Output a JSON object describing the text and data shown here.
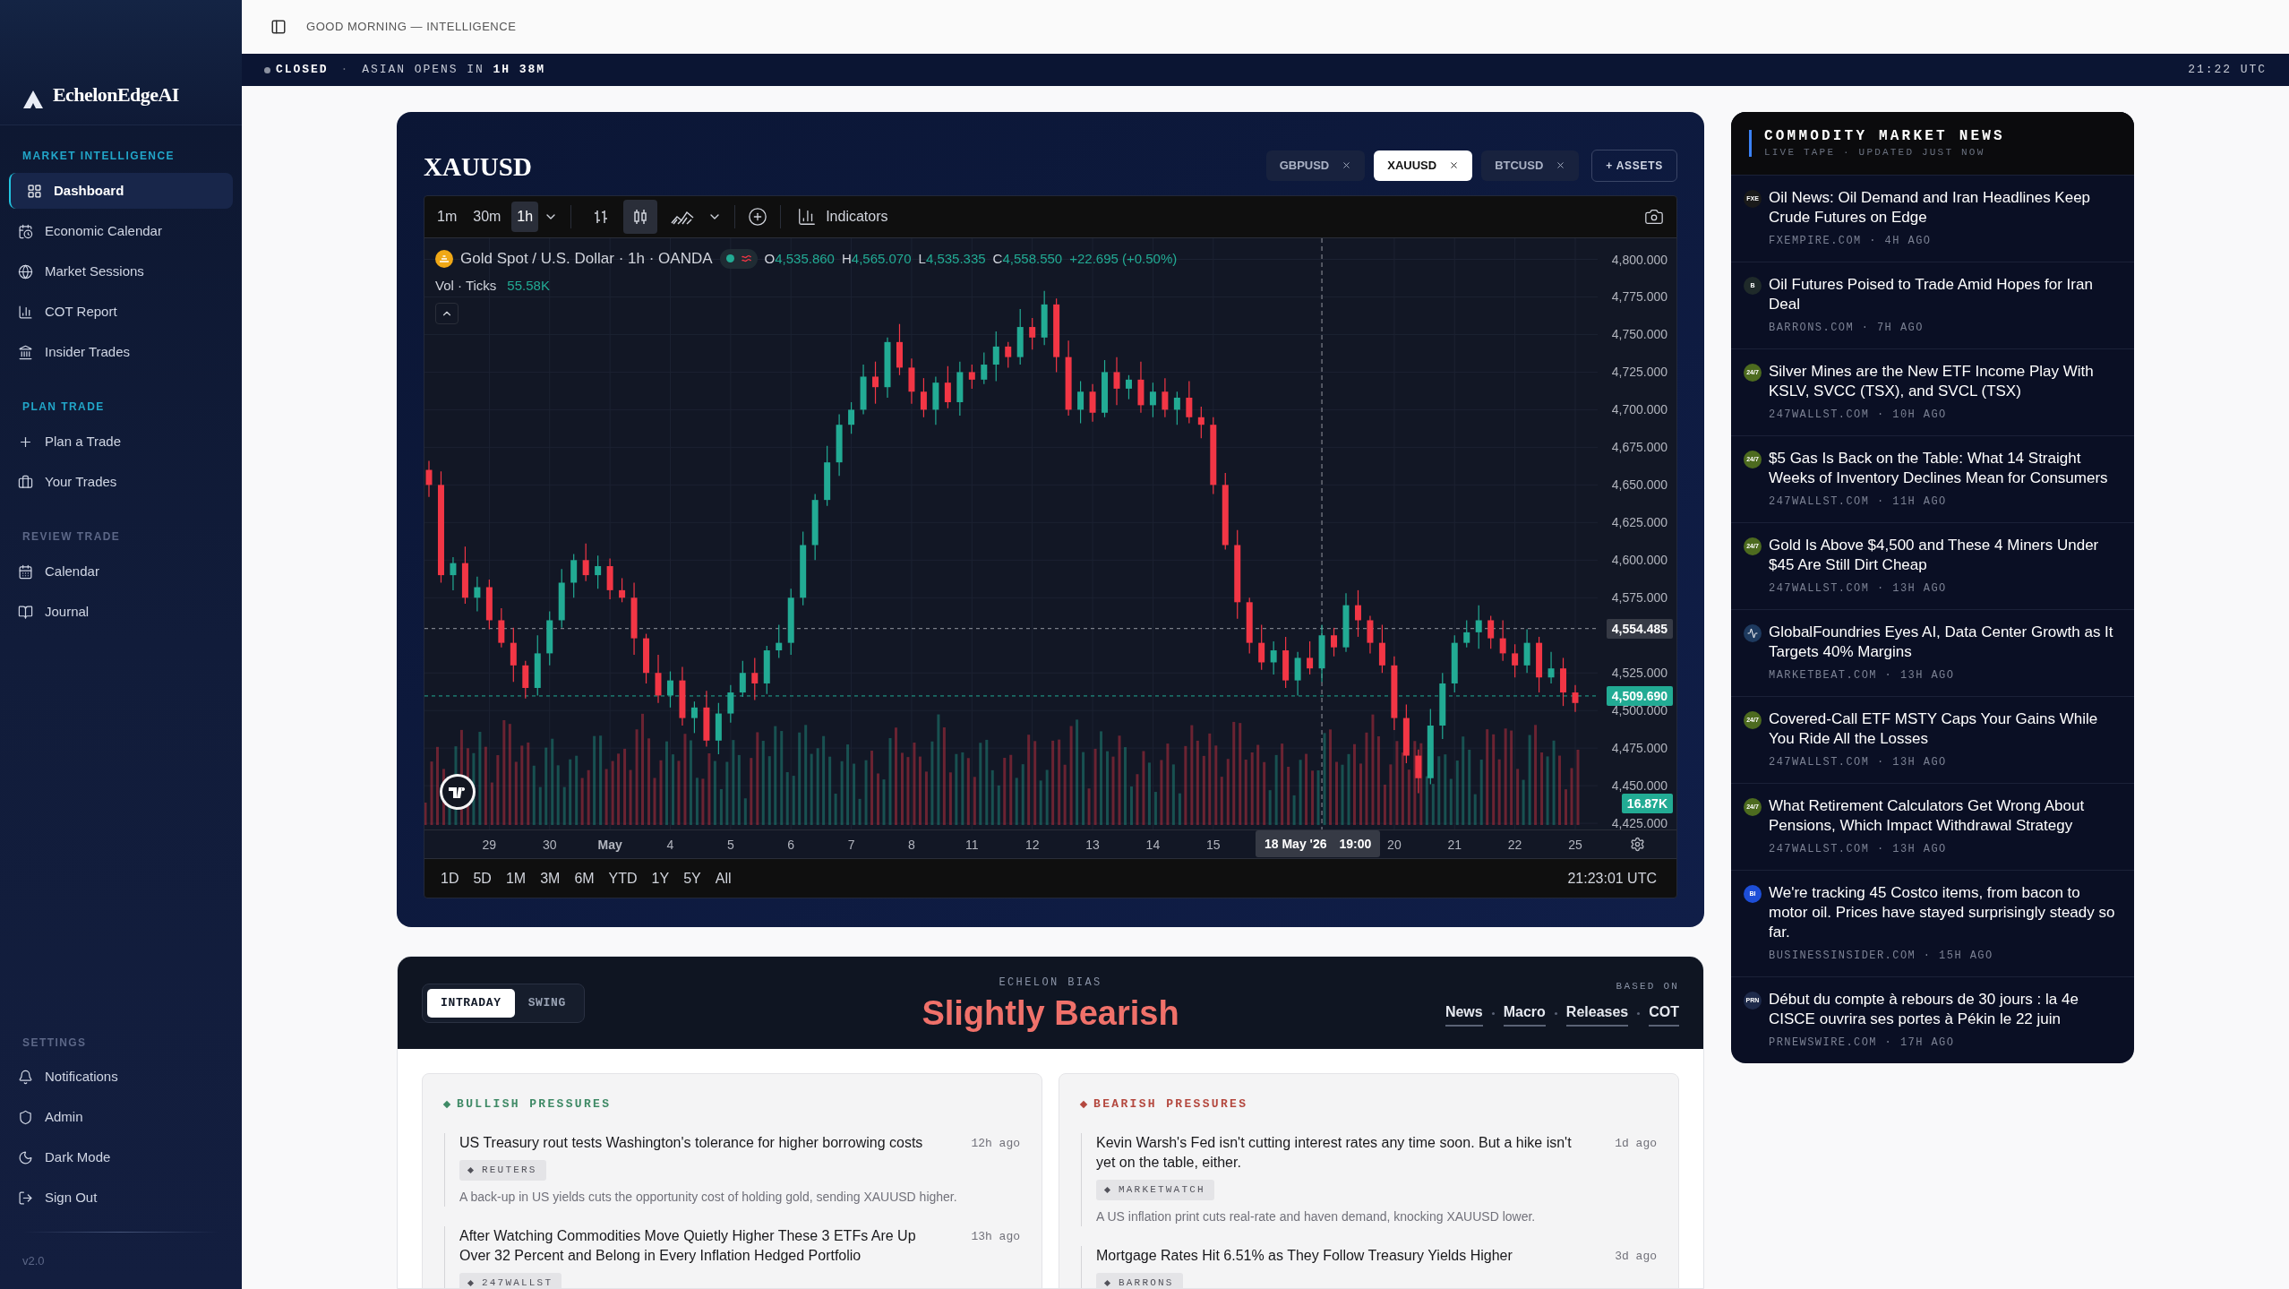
{
  "sidebar": {
    "brand": "EchelonEdgeAI",
    "sections": [
      {
        "title": "MARKET INTELLIGENCE",
        "accent": true,
        "items": [
          {
            "label": "Dashboard",
            "selected": true
          },
          {
            "label": "Economic Calendar",
            "selected": false
          },
          {
            "label": "Market Sessions",
            "selected": false
          },
          {
            "label": "COT Report",
            "selected": false
          },
          {
            "label": "Insider Trades",
            "selected": false
          }
        ]
      },
      {
        "title": "PLAN TRADE",
        "accent": true,
        "items": [
          {
            "label": "Plan a Trade",
            "selected": false
          },
          {
            "label": "Your Trades",
            "selected": false
          }
        ]
      },
      {
        "title": "REVIEW TRADE",
        "accent": false,
        "items": [
          {
            "label": "Calendar",
            "selected": false
          },
          {
            "label": "Journal",
            "selected": false
          }
        ]
      },
      {
        "title": "SETTINGS",
        "accent": false,
        "items": [
          {
            "label": "Notifications",
            "selected": false
          },
          {
            "label": "Admin",
            "selected": false
          },
          {
            "label": "Dark Mode",
            "selected": false
          },
          {
            "label": "Sign Out",
            "selected": false
          }
        ]
      }
    ],
    "version": "v2.0"
  },
  "header": {
    "greeting": "GOOD MORNING — INTELLIGENCE"
  },
  "ticker": {
    "open": false,
    "status": "CLOSED",
    "separator": "·",
    "countdown": "ASIAN OPENS IN **1H 38M**",
    "time": "21:22 UTC"
  },
  "chart_card": {
    "title": "XAUUSD",
    "assets": [
      {
        "label": "GBPUSD",
        "selected": false
      },
      {
        "label": "XAUUSD",
        "selected": true
      },
      {
        "label": "BTCUSD",
        "selected": false
      }
    ],
    "add_button": "+ ASSETS",
    "intervals": [
      {
        "label": "1m",
        "selected": false
      },
      {
        "label": "30m",
        "selected": false
      },
      {
        "label": "1h",
        "selected": true
      }
    ],
    "chart_types": [
      {
        "kind": "bars",
        "selected": false
      },
      {
        "kind": "candles",
        "selected": true
      },
      {
        "kind": "area",
        "selected": false
      }
    ],
    "indicators": "Indicators",
    "legend": {
      "symbol": "Gold Spot / U.S. Dollar · 1h · OANDA",
      "ohlc": [
        {
          "key": "O",
          "value": "4,535.860"
        },
        {
          "key": "H",
          "value": "4,565.070"
        },
        {
          "key": "L",
          "value": "4,535.335"
        },
        {
          "key": "C",
          "value": "4,558.550"
        }
      ],
      "change": "+22.695 (+0.50%)",
      "volume_label": "Vol · Ticks",
      "volume_value": "55.58K"
    },
    "price_markers": [
      {
        "kind": "crosshair",
        "label": "4,554.485"
      },
      {
        "kind": "last",
        "label": "4,509.690"
      },
      {
        "kind": "volume",
        "label": "16.87K"
      }
    ],
    "crosshair_time": {
      "date": "18 May '26",
      "time": "19:00"
    },
    "chart_data": {
      "type": "candlestick",
      "grid": true,
      "ylim": [
        4420.9,
        4814
      ],
      "categories": [
        null,
        null,
        null,
        null,
        null,
        "29",
        null,
        null,
        null,
        null,
        "30",
        null,
        null,
        null,
        null,
        "May",
        null,
        null,
        null,
        null,
        "4",
        null,
        null,
        null,
        null,
        "5",
        null,
        null,
        null,
        null,
        "6",
        null,
        null,
        null,
        null,
        "7",
        null,
        null,
        null,
        null,
        "8",
        null,
        null,
        null,
        null,
        "11",
        null,
        null,
        null,
        null,
        "12",
        null,
        null,
        null,
        null,
        "13",
        null,
        null,
        null,
        null,
        "14",
        null,
        null,
        null,
        null,
        "15",
        null,
        null,
        null,
        null,
        null,
        null,
        null,
        null,
        null,
        null,
        null,
        null,
        null,
        null,
        "20",
        null,
        null,
        null,
        null,
        "21",
        null,
        null,
        null,
        null,
        "22",
        null,
        null,
        null,
        null,
        "25"
      ],
      "ref_lines": [
        {
          "axis": "y",
          "value": 4554.485,
          "color": "#9598a1"
        },
        {
          "axis": "y",
          "value": 4509.69,
          "color": "#22ab94"
        }
      ],
      "yticks": [
        {
          "value": 4800,
          "label": "4,800.000"
        },
        {
          "value": 4775,
          "label": "4,775.000"
        },
        {
          "value": 4750,
          "label": "4,750.000"
        },
        {
          "value": 4725,
          "label": "4,725.000"
        },
        {
          "value": 4700,
          "label": "4,700.000"
        },
        {
          "value": 4675,
          "label": "4,675.000"
        },
        {
          "value": 4650,
          "label": "4,650.000"
        },
        {
          "value": 4625,
          "label": "4,625.000"
        },
        {
          "value": 4600,
          "label": "4,600.000"
        },
        {
          "value": 4575,
          "label": "4,575.000"
        },
        {
          "value": 4525,
          "label": "4,525.000"
        },
        {
          "value": 4500,
          "label": "4,500.000"
        },
        {
          "value": 4475,
          "label": "4,475.000"
        },
        {
          "value": 4450,
          "label": "4,450.000"
        },
        {
          "value": 4425,
          "label": "4,425.000"
        }
      ],
      "ohlc": [
        [
          4660,
          4666,
          4642,
          4650
        ],
        [
          4650,
          4659,
          4585,
          4590
        ],
        [
          4590,
          4602,
          4580,
          4598
        ],
        [
          4598,
          4609,
          4571,
          4575
        ],
        [
          4575,
          4589,
          4566,
          4582
        ],
        [
          4582,
          4587,
          4554,
          4560
        ],
        [
          4560,
          4568,
          4542,
          4545
        ],
        [
          4545,
          4555,
          4519,
          4530
        ],
        [
          4530,
          4533,
          4508,
          4515
        ],
        [
          4515,
          4550,
          4510,
          4538
        ],
        [
          4538,
          4566,
          4530,
          4560
        ],
        [
          4560,
          4594,
          4555,
          4585
        ],
        [
          4585,
          4604,
          4575,
          4600
        ],
        [
          4600,
          4611,
          4586,
          4590
        ],
        [
          4590,
          4603,
          4581,
          4596
        ],
        [
          4596,
          4601,
          4574,
          4580
        ],
        [
          4580,
          4588,
          4572,
          4575
        ],
        [
          4575,
          4585,
          4537,
          4548
        ],
        [
          4548,
          4551,
          4518,
          4525
        ],
        [
          4525,
          4537,
          4505,
          4510
        ],
        [
          4510,
          4526,
          4502,
          4520
        ],
        [
          4520,
          4529,
          4490,
          4495
        ],
        [
          4495,
          4506,
          4485,
          4502
        ],
        [
          4502,
          4513,
          4476,
          4480
        ],
        [
          4480,
          4505,
          4471,
          4498
        ],
        [
          4498,
          4517,
          4492,
          4512
        ],
        [
          4512,
          4533,
          4509,
          4525
        ],
        [
          4525,
          4535,
          4507,
          4518
        ],
        [
          4518,
          4543,
          4511,
          4540
        ],
        [
          4540,
          4557,
          4535,
          4545
        ],
        [
          4545,
          4581,
          4537,
          4575
        ],
        [
          4575,
          4619,
          4570,
          4610
        ],
        [
          4610,
          4644,
          4600,
          4640
        ],
        [
          4640,
          4676,
          4636,
          4665
        ],
        [
          4665,
          4697,
          4656,
          4690
        ],
        [
          4690,
          4705,
          4684,
          4700
        ],
        [
          4700,
          4730,
          4697,
          4722
        ],
        [
          4722,
          4732,
          4704,
          4715
        ],
        [
          4715,
          4748,
          4708,
          4745
        ],
        [
          4745,
          4757,
          4723,
          4728
        ],
        [
          4728,
          4734,
          4704,
          4712
        ],
        [
          4712,
          4721,
          4695,
          4700
        ],
        [
          4700,
          4722,
          4690,
          4718
        ],
        [
          4718,
          4729,
          4701,
          4705
        ],
        [
          4705,
          4732,
          4696,
          4725
        ],
        [
          4725,
          4730,
          4714,
          4720
        ],
        [
          4720,
          4738,
          4717,
          4730
        ],
        [
          4730,
          4752,
          4719,
          4742
        ],
        [
          4742,
          4745,
          4728,
          4735
        ],
        [
          4735,
          4767,
          4730,
          4755
        ],
        [
          4755,
          4761,
          4740,
          4748
        ],
        [
          4748,
          4779,
          4743,
          4770
        ],
        [
          4770,
          4774,
          4725,
          4735
        ],
        [
          4735,
          4746,
          4696,
          4700
        ],
        [
          4700,
          4719,
          4691,
          4712
        ],
        [
          4712,
          4717,
          4692,
          4698
        ],
        [
          4698,
          4733,
          4695,
          4725
        ],
        [
          4725,
          4735,
          4703,
          4714
        ],
        [
          4714,
          4723,
          4707,
          4720
        ],
        [
          4720,
          4732,
          4698,
          4703
        ],
        [
          4703,
          4718,
          4695,
          4712
        ],
        [
          4712,
          4721,
          4695,
          4700
        ],
        [
          4700,
          4712,
          4690,
          4708
        ],
        [
          4708,
          4719,
          4691,
          4695
        ],
        [
          4695,
          4702,
          4681,
          4690
        ],
        [
          4690,
          4695,
          4644,
          4650
        ],
        [
          4650,
          4658,
          4607,
          4610
        ],
        [
          4610,
          4620,
          4561,
          4572
        ],
        [
          4572,
          4575,
          4538,
          4545
        ],
        [
          4545,
          4557,
          4527,
          4532
        ],
        [
          4532,
          4546,
          4524,
          4540
        ],
        [
          4540,
          4549,
          4515,
          4520
        ],
        [
          4520,
          4539,
          4510,
          4535
        ],
        [
          4535,
          4546,
          4524,
          4528
        ],
        [
          4528,
          4557,
          4519,
          4550
        ],
        [
          4550,
          4555,
          4536,
          4542
        ],
        [
          4542,
          4578,
          4539,
          4570
        ],
        [
          4570,
          4580,
          4549,
          4560
        ],
        [
          4560,
          4563,
          4538,
          4545
        ],
        [
          4545,
          4557,
          4525,
          4530
        ],
        [
          4530,
          4536,
          4487,
          4495
        ],
        [
          4495,
          4504,
          4465,
          4470
        ],
        [
          4470,
          4474,
          4445,
          4455
        ],
        [
          4455,
          4501,
          4451,
          4490
        ],
        [
          4490,
          4525,
          4481,
          4518
        ],
        [
          4518,
          4550,
          4512,
          4545
        ],
        [
          4545,
          4560,
          4542,
          4552
        ],
        [
          4552,
          4570,
          4541,
          4560
        ],
        [
          4560,
          4563,
          4541,
          4548
        ],
        [
          4548,
          4560,
          4533,
          4538
        ],
        [
          4538,
          4544,
          4522,
          4530
        ],
        [
          4530,
          4554,
          4525,
          4545
        ],
        [
          4545,
          4549,
          4512,
          4522
        ],
        [
          4522,
          4539,
          4518,
          4528
        ],
        [
          4528,
          4535,
          4503,
          4512
        ],
        [
          4512,
          4517,
          4499,
          4505
        ]
      ]
    },
    "ranges": [
      "1D",
      "5D",
      "1M",
      "3M",
      "6M",
      "YTD",
      "1Y",
      "5Y",
      "All"
    ],
    "clock": "21:23:01 UTC"
  },
  "bias": {
    "modes": [
      {
        "label": "INTRADAY",
        "selected": true
      },
      {
        "label": "SWING",
        "selected": false
      }
    ],
    "caption": "ECHELON BIAS",
    "verdict": "Slightly Bearish",
    "based_on": "BASED ON",
    "sources": [
      "News",
      "Macro",
      "Releases",
      "COT"
    ],
    "columns": [
      {
        "kind": "bullish",
        "title": "BULLISH PRESSURES",
        "items": [
          {
            "title": "US Treasury rout tests Washington's tolerance for higher borrowing costs",
            "time": "12h ago",
            "source": "REUTERS",
            "summary": "A back-up in US yields cuts the opportunity cost of holding gold, sending XAUUSD higher."
          },
          {
            "title": "After Watching Commodities Move Quietly Higher These 3 ETFs Are Up Over 32 Percent and Belong in Every Inflation Hedged Portfolio",
            "time": "13h ago",
            "source": "247WALLST"
          }
        ]
      },
      {
        "kind": "bearish",
        "title": "BEARISH PRESSURES",
        "items": [
          {
            "title": "Kevin Warsh's Fed isn't cutting interest rates any time soon. But a hike isn't yet on the table, either.",
            "time": "1d ago",
            "source": "MARKETWATCH",
            "summary": "A US inflation print cuts real-rate and haven demand, knocking XAUUSD lower."
          },
          {
            "title": "Mortgage Rates Hit 6.51% as They Follow Treasury Yields Higher",
            "time": "3d ago",
            "source": "BARRONS"
          }
        ]
      }
    ]
  },
  "news": {
    "title": "COMMODITY MARKET NEWS",
    "subtitle": "LIVE TAPE · UPDATED JUST NOW",
    "items": [
      {
        "logo": {
          "kind": "letters",
          "text": "FXE"
        },
        "color": "#1a1a1a",
        "title": "Oil News: Oil Demand and Iran Headlines Keep Crude Futures on Edge",
        "meta": "FXEMPIRE.COM · 4H AGO"
      },
      {
        "logo": {
          "kind": "letters",
          "text": "B"
        },
        "color": "#1f2a2a",
        "title": "Oil Futures Poised to Trade Amid Hopes for Iran Deal",
        "meta": "BARRONS.COM · 7H AGO"
      },
      {
        "logo": {
          "kind": "letters",
          "text": "24/7"
        },
        "color": "#4d6b1f",
        "title": "Silver Mines are the New ETF Income Play With KSLV, SVCC (TSX), and SVCL (TSX)",
        "meta": "247WALLST.COM · 10H AGO"
      },
      {
        "logo": {
          "kind": "letters",
          "text": "24/7"
        },
        "color": "#4d6b1f",
        "title": "$5 Gas Is Back on the Table: What 14 Straight Weeks of Inventory Declines Mean for Consumers",
        "meta": "247WALLST.COM · 11H AGO"
      },
      {
        "logo": {
          "kind": "letters",
          "text": "24/7"
        },
        "color": "#4d6b1f",
        "title": "Gold Is Above $4,500 and These 4 Miners Under $45 Are Still Dirt Cheap",
        "meta": "247WALLST.COM · 13H AGO"
      },
      {
        "logo": {
          "kind": "pulse"
        },
        "color": "#1e3a5f",
        "title": "GlobalFoundries Eyes AI, Data Center Growth as It Targets 40% Margins",
        "meta": "MARKETBEAT.COM · 13H AGO"
      },
      {
        "logo": {
          "kind": "letters",
          "text": "24/7"
        },
        "color": "#4d6b1f",
        "title": "Covered-Call ETF MSTY Caps Your Gains While You Ride All the Losses",
        "meta": "247WALLST.COM · 13H AGO"
      },
      {
        "logo": {
          "kind": "letters",
          "text": "24/7"
        },
        "color": "#4d6b1f",
        "title": "What Retirement Calculators Get Wrong About Pensions, Which Impact Withdrawal Strategy",
        "meta": "247WALLST.COM · 13H AGO"
      },
      {
        "logo": {
          "kind": "letters",
          "text": "BI"
        },
        "color": "#1d4ed8",
        "title": "We're tracking 45 Costco items, from bacon to motor oil. Prices have stayed surprisingly steady so far.",
        "meta": "BUSINESSINSIDER.COM · 15H AGO"
      },
      {
        "logo": {
          "kind": "letters",
          "text": "PRN"
        },
        "color": "#1e2a4a",
        "title": "Début du compte à rebours de 30 jours : la 4e CISCE ouvrira ses portes à Pékin le 22 juin",
        "meta": "PRNEWSWIRE.COM · 17H AGO"
      }
    ]
  }
}
